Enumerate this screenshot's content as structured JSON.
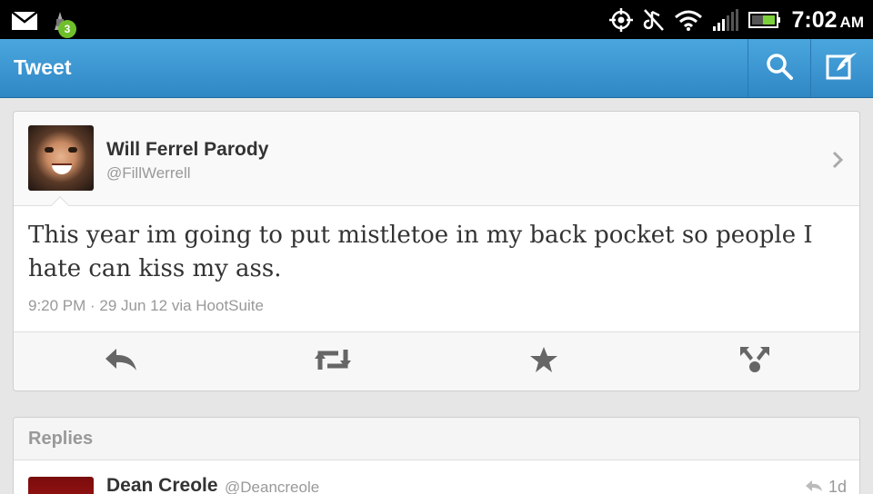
{
  "status_bar": {
    "notification_count": "3",
    "time": "7:02",
    "ampm": "AM",
    "icons": [
      "mail-icon",
      "app-update-icon",
      "gps-icon",
      "silent-icon",
      "wifi-icon",
      "signal-icon",
      "battery-icon"
    ]
  },
  "action_bar": {
    "title": "Tweet",
    "color": "#3d97d3",
    "buttons": [
      "search-icon",
      "compose-icon"
    ]
  },
  "tweet": {
    "author_name": "Will Ferrel Parody",
    "author_handle": "@FillWerrell",
    "text": "This year im going to put mistletoe in my back pocket so people I hate can kiss my ass.",
    "meta": "9:20 PM · 29 Jun 12 via HootSuite",
    "actions": [
      "reply-icon",
      "retweet-icon",
      "favorite-icon",
      "share-icon"
    ]
  },
  "replies": {
    "title": "Replies",
    "items": [
      {
        "name": "Dean Creole",
        "handle": "@Deancreole",
        "time": "1d"
      }
    ]
  }
}
